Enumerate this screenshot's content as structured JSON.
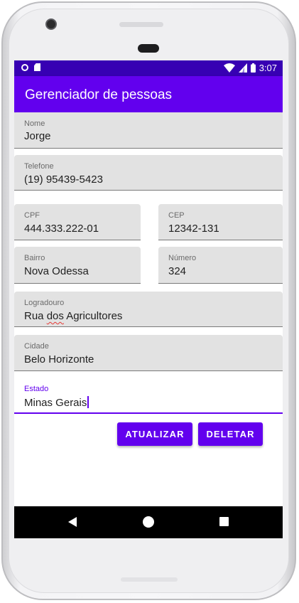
{
  "status_bar": {
    "time": "3:07",
    "icons": [
      "record-circle-icon",
      "sd-card-icon",
      "wifi-icon",
      "signal-icon",
      "battery-icon"
    ]
  },
  "app_bar": {
    "title": "Gerenciador de pessoas"
  },
  "form": {
    "nome": {
      "label": "Nome",
      "value": "Jorge"
    },
    "telefone": {
      "label": "Telefone",
      "value": "(19) 95439-5423"
    },
    "cpf": {
      "label": "CPF",
      "value": "444.333.222-01"
    },
    "cep": {
      "label": "CEP",
      "value": "12342-131"
    },
    "bairro": {
      "label": "Bairro",
      "value": "Nova Odessa"
    },
    "numero": {
      "label": "Número",
      "value": "324"
    },
    "logradouro": {
      "label": "Logradouro",
      "value_prefix": "Rua ",
      "value_misspelled": "dos",
      "value_suffix": " Agricultores"
    },
    "cidade": {
      "label": "Cidade",
      "value": "Belo Horizonte"
    },
    "estado": {
      "label": "Estado",
      "value": "Minas Gerais"
    }
  },
  "actions": {
    "update_label": "ATUALIZAR",
    "delete_label": "DELETAR"
  },
  "navigation": {
    "icons": [
      "back-icon",
      "home-icon",
      "recents-icon"
    ]
  },
  "colors": {
    "primary": "#6200ee",
    "primary_dark": "#3700b3",
    "field_background": "#e2e2e2"
  }
}
